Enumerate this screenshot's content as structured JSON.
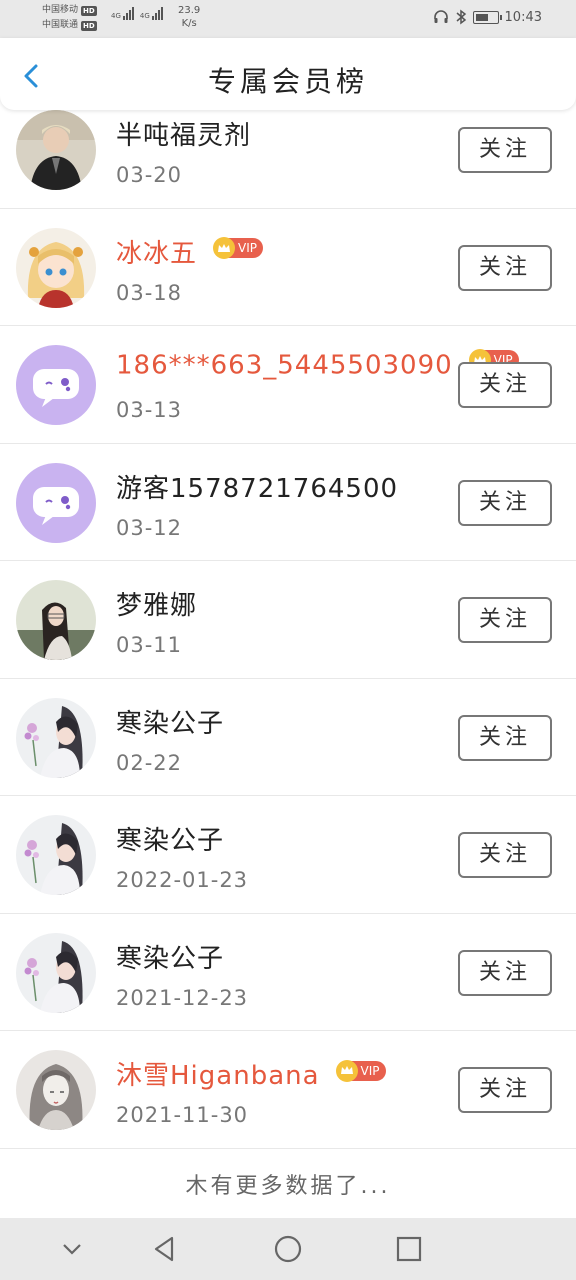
{
  "status_bar": {
    "carrier1": "中国移动",
    "carrier2": "中国联通",
    "hd": "HD",
    "net1": "4G",
    "net2": "4G",
    "speed_value": "23.9",
    "speed_unit": "K/s",
    "time": "10:43",
    "battery_level": 0.55
  },
  "header": {
    "title": "专属会员榜"
  },
  "follow_label": "关注",
  "vip_label": "VIP",
  "members": [
    {
      "name": "半吨福灵剂",
      "date": "03-20",
      "vip": false,
      "avatar": "photo-dark"
    },
    {
      "name": "冰冰五",
      "date": "03-18",
      "vip": true,
      "avatar": "anime-girl"
    },
    {
      "name": "186***663_5445503090",
      "date": "03-13",
      "vip": true,
      "avatar": "default-chat"
    },
    {
      "name": "游客1578721764500",
      "date": "03-12",
      "vip": false,
      "avatar": "default-chat"
    },
    {
      "name": "梦雅娜",
      "date": "03-11",
      "vip": false,
      "avatar": "photo-girl"
    },
    {
      "name": "寒染公子",
      "date": "02-22",
      "vip": false,
      "avatar": "painting"
    },
    {
      "name": "寒染公子",
      "date": "2022-01-23",
      "vip": false,
      "avatar": "painting"
    },
    {
      "name": "寒染公子",
      "date": "2021-12-23",
      "vip": false,
      "avatar": "painting"
    },
    {
      "name": "沐雪Higanbana",
      "date": "2021-11-30",
      "vip": true,
      "avatar": "sketch"
    }
  ],
  "footer": {
    "no_more": "木有更多数据了..."
  },
  "colors": {
    "vip_name": "#e5583d",
    "vip_badge": "#e8604d",
    "accent_blue": "#2a8fd8",
    "default_avatar": "#c9b3f0"
  }
}
